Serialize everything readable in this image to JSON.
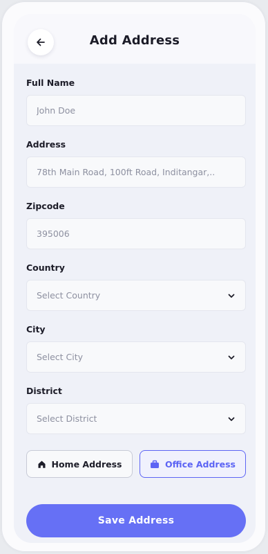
{
  "header": {
    "title": "Add Address",
    "back_icon": "arrow-left-icon"
  },
  "form": {
    "full_name": {
      "label": "Full Name",
      "placeholder": "John Doe"
    },
    "address": {
      "label": "Address",
      "placeholder": "78th Main Road, 100ft Road, Inditangar,.."
    },
    "zipcode": {
      "label": "Zipcode",
      "placeholder": "395006"
    },
    "country": {
      "label": "Country",
      "selected": "Select Country",
      "icon": "chevron-down-icon"
    },
    "city": {
      "label": "City",
      "selected": "Select City",
      "icon": "chevron-down-icon"
    },
    "district": {
      "label": "District",
      "selected": "Select District",
      "icon": "chevron-down-icon"
    }
  },
  "address_types": {
    "home": {
      "label": "Home Address",
      "icon": "home-icon",
      "selected": false
    },
    "office": {
      "label": "Office Address",
      "icon": "briefcase-icon",
      "selected": true
    }
  },
  "save_button": {
    "label": "Save Address"
  },
  "colors": {
    "accent": "#6670f5",
    "accent_border": "#5c64f4",
    "text_dark": "#1c1c28",
    "placeholder": "#8d90a0",
    "screen_bg": "#eff1f8"
  }
}
